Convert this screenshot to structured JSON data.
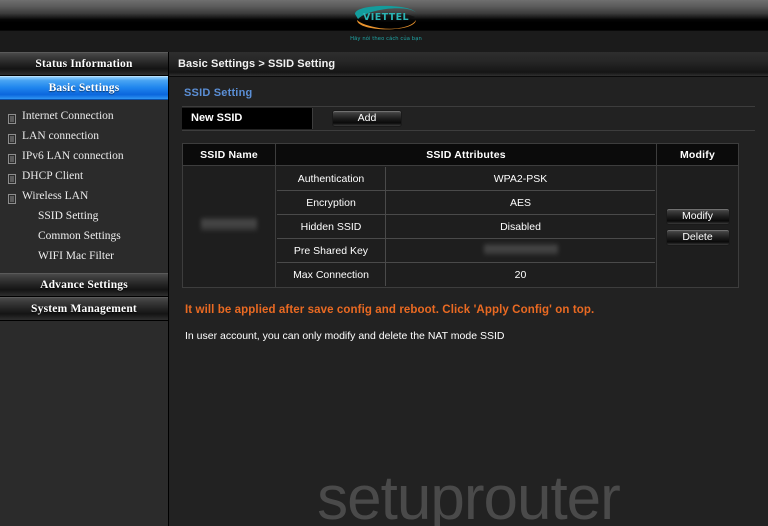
{
  "header": {
    "logo_name": "VIETTEL",
    "logo_tagline": "Hãy nói theo cách của bạn",
    "teal": "#1fa5a5",
    "orange": "#e8922d"
  },
  "sidebar": {
    "status_information": "Status Information",
    "basic_settings": "Basic Settings",
    "items": [
      {
        "label": "Internet Connection",
        "icon": "document-icon"
      },
      {
        "label": "LAN connection",
        "icon": "document-icon"
      },
      {
        "label": "IPv6 LAN connection",
        "icon": "document-icon"
      },
      {
        "label": "DHCP Client",
        "icon": "document-icon"
      },
      {
        "label": "Wireless LAN",
        "icon": "document-icon"
      }
    ],
    "subitems": [
      {
        "label": "SSID Setting"
      },
      {
        "label": "Common Settings"
      },
      {
        "label": "WIFI Mac Filter"
      }
    ],
    "advance_settings": "Advance Settings",
    "system_management": "System Management"
  },
  "main": {
    "breadcrumb": "Basic Settings > SSID Setting",
    "section_title": "SSID Setting",
    "section_title_color": "#5b8fd6",
    "new_ssid_label": "New SSID",
    "add_button": "Add",
    "table": {
      "headers": [
        "SSID Name",
        "SSID Attributes",
        "Modify"
      ],
      "ssid_name_value": "",
      "attributes": [
        {
          "label": "Authentication",
          "value": "WPA2-PSK"
        },
        {
          "label": "Encryption",
          "value": "AES"
        },
        {
          "label": "Hidden SSID",
          "value": "Disabled"
        },
        {
          "label": "Pre Shared Key",
          "value": ""
        },
        {
          "label": "Max Connection",
          "value": "20"
        }
      ],
      "modify_button": "Modify",
      "delete_button": "Delete"
    },
    "warning_text": "It will be applied after save config and reboot. Click 'Apply Config' on top.",
    "warning_color": "#ea6a22",
    "info_text": "In user account, you can only modify and delete the NAT mode SSID",
    "watermark": "setuprouter"
  }
}
